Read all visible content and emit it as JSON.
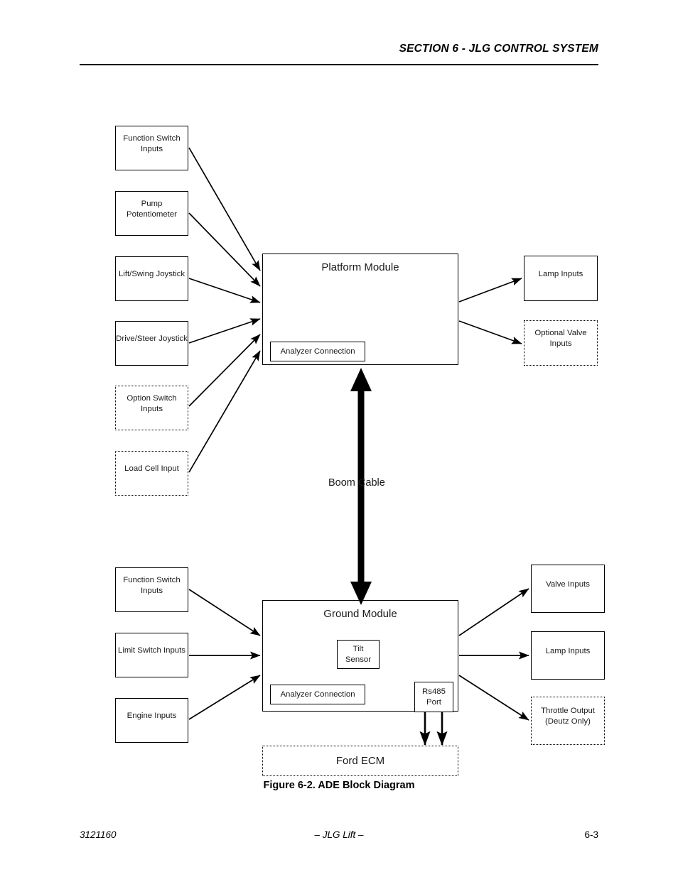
{
  "header": {
    "section_title": "SECTION 6 - JLG CONTROL SYSTEM"
  },
  "figure": {
    "caption": "Figure 6-2.  ADE Block Diagram",
    "cable_label": "Boom Cable",
    "platform_module": {
      "title": "Platform Module",
      "analyzer_connection": "Analyzer Connection"
    },
    "ground_module": {
      "title": "Ground Module",
      "tilt_sensor": "Tilt\nSensor",
      "tilt_sensor_line1": "Tilt",
      "tilt_sensor_line2": "Sensor",
      "analyzer_connection": "Analyzer Connection",
      "rs485_line1": "Rs485",
      "rs485_line2": "Port"
    },
    "platform_inputs": [
      {
        "label_line1": "Function Switch",
        "label_line2": "Inputs",
        "style": "solid"
      },
      {
        "label_line1": "Pump",
        "label_line2": "Potentiometer",
        "style": "solid"
      },
      {
        "label_line1": "Lift/Swing Joystick",
        "label_line2": "",
        "style": "solid"
      },
      {
        "label_line1": "Drive/Steer Joystick",
        "label_line2": "",
        "style": "solid"
      },
      {
        "label_line1": "Option Switch",
        "label_line2": "Inputs",
        "style": "dotted"
      },
      {
        "label_line1": "Load Cell Input",
        "label_line2": "",
        "style": "dotted"
      }
    ],
    "platform_outputs": [
      {
        "label_line1": "Lamp Inputs",
        "label_line2": "",
        "style": "solid"
      },
      {
        "label_line1": "Optional Valve",
        "label_line2": "Inputs",
        "style": "dotted"
      }
    ],
    "ground_inputs": [
      {
        "label_line1": "Function Switch",
        "label_line2": "Inputs",
        "style": "solid"
      },
      {
        "label_line1": "Limit Switch Inputs",
        "label_line2": "",
        "style": "solid"
      },
      {
        "label_line1": "Engine Inputs",
        "label_line2": "",
        "style": "solid"
      }
    ],
    "ground_outputs": [
      {
        "label_line1": "Valve Inputs",
        "label_line2": "",
        "style": "solid"
      },
      {
        "label_line1": "Lamp Inputs",
        "label_line2": "",
        "style": "solid"
      },
      {
        "label_line1": "Throttle Output",
        "label_line2": "(Deutz Only)",
        "style": "dotted"
      }
    ],
    "ecm": {
      "label": "Ford ECM"
    }
  },
  "footer": {
    "document_number": "3121160",
    "center": "– JLG Lift –",
    "page_number": "6-3"
  },
  "colors": {
    "ink": "#000000",
    "text": "#1a1a1a",
    "page": "#ffffff"
  }
}
